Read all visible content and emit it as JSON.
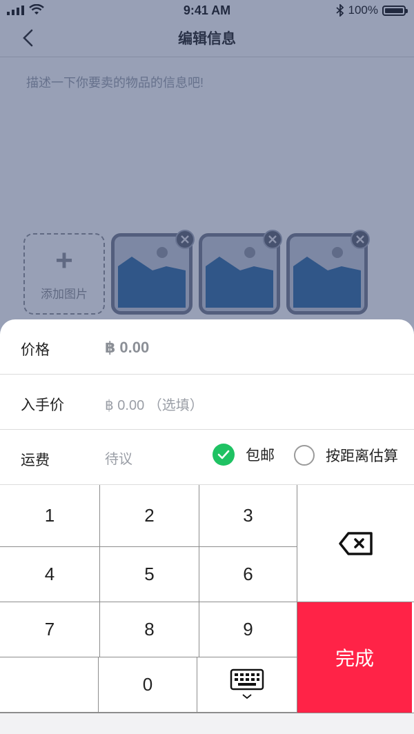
{
  "status_bar": {
    "time": "9:41 AM",
    "battery": "100%"
  },
  "nav": {
    "title": "编辑信息"
  },
  "description": {
    "placeholder": "描述一下你要卖的物品的信息吧!"
  },
  "photos": {
    "add_label": "添加图片",
    "add_symbol": "+"
  },
  "form": {
    "price": {
      "label": "价格",
      "value": "฿ 0.00"
    },
    "original_price": {
      "label": "入手价",
      "value": "฿ 0.00 （选填）"
    },
    "shipping": {
      "label": "运费",
      "value": "待议",
      "option_free": "包邮",
      "option_distance": "按距离估算"
    }
  },
  "keypad": {
    "k1": "1",
    "k2": "2",
    "k3": "3",
    "k4": "4",
    "k5": "5",
    "k6": "6",
    "k7": "7",
    "k8": "8",
    "k9": "9",
    "k0": "0",
    "done": "完成"
  },
  "colors": {
    "accent_done": "#ff2347",
    "radio_checked": "#1fc263",
    "overlay": "rgba(50,65,110,0.5)"
  }
}
